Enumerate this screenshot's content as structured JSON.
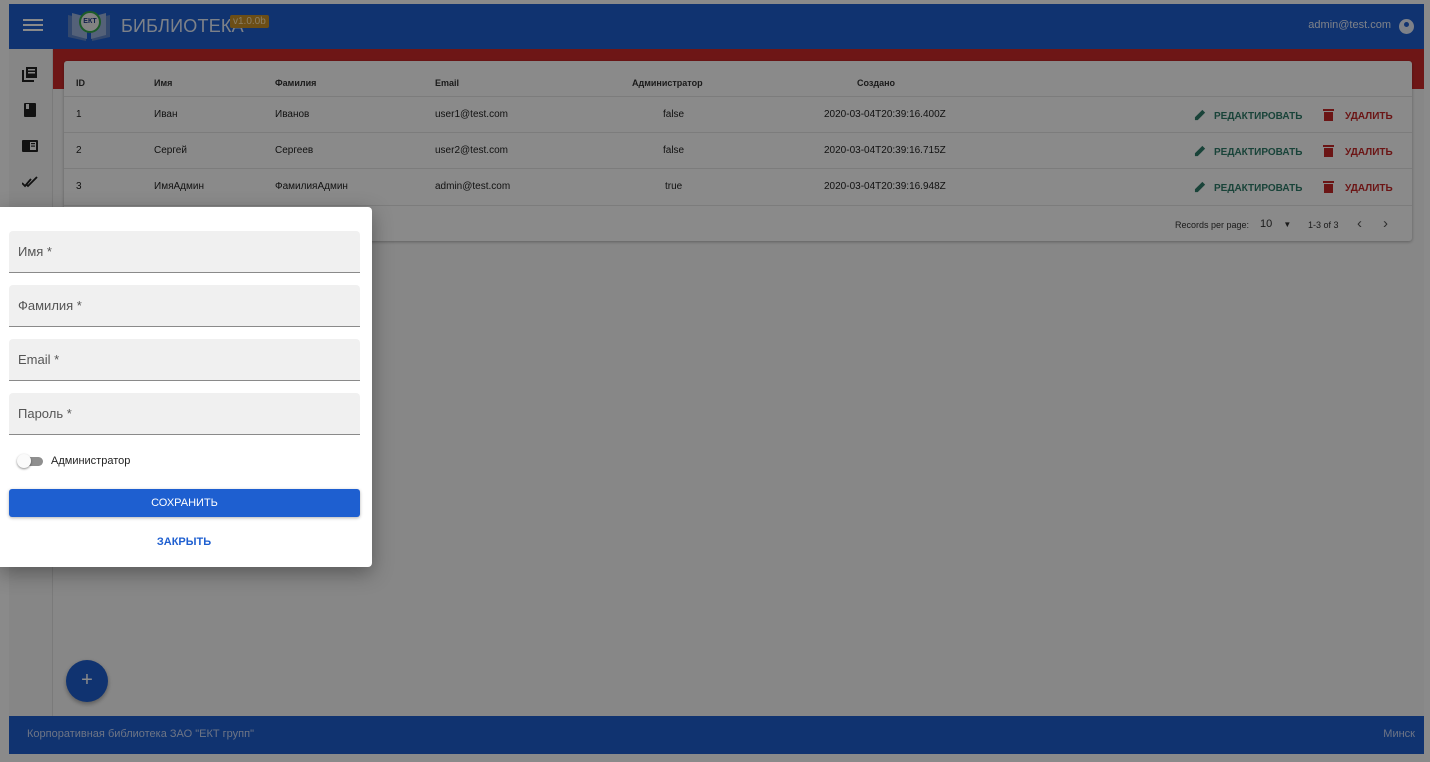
{
  "appbar": {
    "title": "БИБЛИОТЕКА",
    "version": "v1.0.0b",
    "logo_text": "ЕКТ",
    "user_email": "admin@test.com"
  },
  "sidebar": {
    "icons": [
      "library-books-icon",
      "book-icon",
      "chrome-reader-icon",
      "done-all-icon"
    ]
  },
  "table": {
    "headers": [
      "ID",
      "Имя",
      "Фамилия",
      "Email",
      "Администратор",
      "Создано"
    ],
    "rows": [
      [
        "1",
        "Иван",
        "Иванов",
        "user1@test.com",
        "false",
        "2020-03-04T20:39:16.400Z"
      ],
      [
        "2",
        "Сергей",
        "Сергеев",
        "user2@test.com",
        "false",
        "2020-03-04T20:39:16.715Z"
      ],
      [
        "3",
        "ИмяАдмин",
        "ФамилияАдмин",
        "admin@test.com",
        "true",
        "2020-03-04T20:39:16.948Z"
      ]
    ],
    "edit_label": "РЕДАКТИРОВАТЬ",
    "delete_label": "УДАЛИТЬ",
    "pager": {
      "records_label": "Records per page:",
      "per_page": "10",
      "range": "1-3 of 3"
    }
  },
  "dialog": {
    "fields": [
      {
        "label": "Имя *"
      },
      {
        "label": "Фамилия *"
      },
      {
        "label": "Email *"
      },
      {
        "label": "Пароль *"
      }
    ],
    "admin_toggle_label": "Администратор",
    "admin_toggle_on": false,
    "save_label": "СОХРАНИТЬ",
    "close_label": "ЗАКРЫТЬ"
  },
  "fab": {
    "label": "+"
  },
  "footer": {
    "left": "Корпоративная библиотека ЗАО \"ЕКТ групп\"",
    "right": "Минск"
  },
  "colors": {
    "primary": "#1e5fd0",
    "edit": "#2f7d6a",
    "delete": "#c62828",
    "version_badge": "#c8902a",
    "strip": "#cc2a2a"
  }
}
